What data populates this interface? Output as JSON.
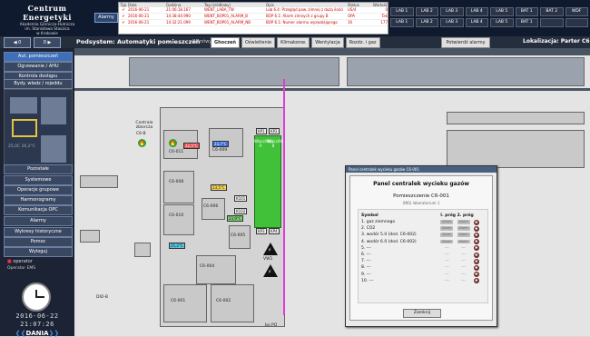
{
  "brand": {
    "title": "Centrum Energetyki",
    "line1": "Akademia Górniczo-Hutnicza",
    "line2": "im. Stanisława Staszica",
    "line3": "w Krakowie"
  },
  "alarms_button": "Alarmy",
  "alarm_table": {
    "headers": [
      "Typ",
      "Data",
      "Godzina",
      "Tag (źródłowy)",
      "Opis",
      "Status",
      "Wartość"
    ],
    "rows": [
      {
        "date": "2016-06-21",
        "time": "21:06:18.167",
        "tag": "WENT_LABA_TW",
        "desc": "Lab 6.4: Przegląd pow. zimnej z dużą ilości",
        "status": "US/4",
        "value": "0"
      },
      {
        "date": "2016-06-21",
        "time": "14:38:44.990",
        "tag": "WENT_BOP01_ALARM_B",
        "desc": "BOP 6.1: Alarm zimnych z grupy B",
        "status": "OPA",
        "value": "Tak"
      },
      {
        "date": "2016-06-21",
        "time": "14:32:21.099",
        "tag": "WENT_BOP01_ALARM_NB",
        "desc": "BOP 6.1: Numer alarmu wyzwalającego",
        "status": "16",
        "value": "177"
      }
    ]
  },
  "module_buttons": [
    "LAB 1",
    "LAB 2",
    "LAB 3",
    "LAB 4",
    "LAB 5",
    "BAT 1",
    "BAT 2",
    "WDF",
    "LAB 1",
    "LAB 2",
    "LAB 3",
    "LAB 4",
    "LAB 5",
    "BAT 1",
    "",
    ""
  ],
  "page_buttons": [
    "◀ 0",
    "0 ▶"
  ],
  "subsystem": "Podsystem: Automatyki pomieszczeń",
  "variants_label": "Warstwy:",
  "variant_tabs": [
    "Ghoczeń",
    "Oświetlenie",
    "Klimakonw.",
    "Wentylacja",
    "Rozdz. i gaz"
  ],
  "ack_button": "Potwierdź alarmy",
  "location": "Lokalizacja: Parter C6",
  "sidebar": {
    "buttons": [
      "Aut. pomieszczeń",
      "Ogrzewanie / AHU",
      "Kontrola dostępu",
      "Bydy. władz / rojeddu"
    ],
    "lower_buttons": [
      "Pozostałe",
      "Systemowe",
      "Operacje grupowe",
      "Harmonogramy",
      "Komunikacja OPC",
      "Alarmy",
      "Wykresy historyczne",
      "Pomoc",
      "Wyloguj"
    ],
    "temp1": "25,0C 26,2°C",
    "temp2": "25,0C 26,2°C",
    "operator_label": "operator",
    "operator_role": "Operator EMS",
    "date": "2016-06-22",
    "time": "21:07:26",
    "logo": "DANIA"
  },
  "map": {
    "central_label": "Centrala zbiorcza",
    "central_room": "C6-B",
    "rooms": [
      "C6-001",
      "C6-002",
      "C6-004",
      "C6-005",
      "C6-006",
      "C6-008",
      "C6-009",
      "C6-010",
      "C6-011"
    ],
    "tags": [
      "22,5°C",
      "23,7°C",
      "23,5°C",
      "25,2°C",
      "23,9°C",
      "K101",
      "K102",
      "KP1",
      "KP2",
      "KP3",
      "KP4"
    ],
    "green_rooms": [
      "Wlącz/Wył. A",
      "Wlącz/Wył. B"
    ],
    "warn_label": "VW1",
    "bottom_label": "DIO-B",
    "map_bottom_right": "bo PO"
  },
  "dialog": {
    "window_title": "Panel centralek wycieku gazów C6-001",
    "title": "Panel centralek wycieku gazów",
    "room": "Pomieszczenie C6-001",
    "room_sub": "(INS) laboratorium 1",
    "col_symbol": "Symbol",
    "col_prog1": "I. próg",
    "col_prog2": "2. próg",
    "rows": [
      {
        "label": "1. gaz ziemnego",
        "p1": "Alarm",
        "p2": "Alarm"
      },
      {
        "label": "2. CO2",
        "p1": "Alarm",
        "p2": "Alarm"
      },
      {
        "label": "3. wodór 5.0 (dod. C6-002)",
        "p1": "Alarm",
        "p2": "Alarm"
      },
      {
        "label": "4. wodór 6.0 (dod. C6-002)",
        "p1": "Alarm",
        "p2": "Alarm"
      },
      {
        "label": "5. ---",
        "p1": "---",
        "p2": "---"
      },
      {
        "label": "6. ---",
        "p1": "---",
        "p2": "---"
      },
      {
        "label": "7. ---",
        "p1": "---",
        "p2": "---"
      },
      {
        "label": "8. ---",
        "p1": "---",
        "p2": "---"
      },
      {
        "label": "9. ---",
        "p1": "---",
        "p2": "---"
      },
      {
        "label": "10. ---",
        "p1": "---",
        "p2": "---"
      }
    ],
    "close_button": "Zamknij"
  }
}
